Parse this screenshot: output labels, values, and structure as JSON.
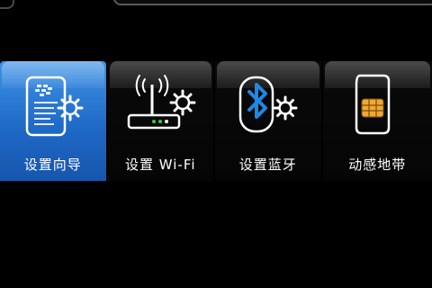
{
  "header": {
    "search_bar": "",
    "left_control": ""
  },
  "tiles": [
    {
      "label": "设置向导",
      "icon": "setup-wizard-icon",
      "selected": true
    },
    {
      "label": "设置 Wi-Fi",
      "icon": "wifi-router-settings-icon",
      "selected": false
    },
    {
      "label": "设置蓝牙",
      "icon": "bluetooth-settings-icon",
      "selected": false
    },
    {
      "label": "动感地带",
      "icon": "sim-card-icon",
      "selected": false
    }
  ],
  "colors": {
    "background": "#000000",
    "selected_tile": "#1f69c7",
    "tile_cap": "#4b4b4b",
    "label_text": "#ffffff",
    "bluetooth": "#1e88e5",
    "sim_chip": "#f0a830"
  }
}
